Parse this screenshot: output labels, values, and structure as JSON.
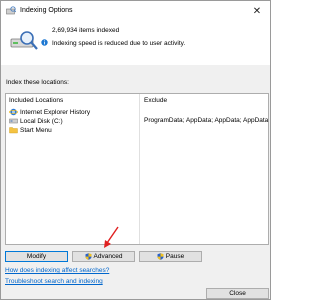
{
  "window": {
    "title": "Indexing Options",
    "close_glyph": "✕"
  },
  "status": {
    "items_indexed": "2,69,934 items indexed",
    "speed_message": "Indexing speed is reduced due to user activity."
  },
  "locations": {
    "section_label": "Index these locations:",
    "columns": {
      "included": "Included Locations",
      "exclude": "Exclude"
    },
    "rows": [
      {
        "name": "Internet Explorer History",
        "icon": "ie-icon",
        "exclude": ""
      },
      {
        "name": "Local Disk (C:)",
        "icon": "drive-icon",
        "exclude": "ProgramData; AppData; AppData; AppData"
      },
      {
        "name": "Start Menu",
        "icon": "folder-icon",
        "exclude": ""
      }
    ]
  },
  "buttons": {
    "modify": "Modify",
    "advanced": "Advanced",
    "pause": "Pause",
    "close": "Close"
  },
  "links": {
    "how_affect": "How does indexing affect searches?",
    "troubleshoot": "Troubleshoot search and indexing"
  },
  "colors": {
    "link": "#0066cc",
    "arrow": "#e02020",
    "focus": "#0078d7"
  }
}
